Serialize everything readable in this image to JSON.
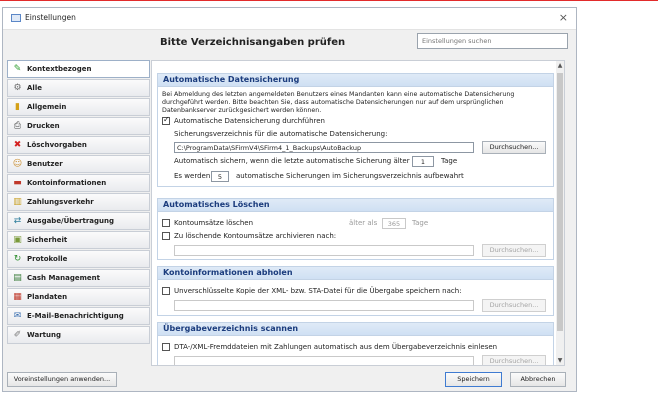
{
  "window": {
    "title": "Einstellungen",
    "close_glyph": "×"
  },
  "heading": "Bitte Verzeichnisangaben prüfen",
  "search": {
    "placeholder": "Einstellungen suchen"
  },
  "sidebar": {
    "items": [
      {
        "label": "Kontextbezogen",
        "icon": "pencil-icon",
        "glyph": "✎",
        "color": "#2f9e2f",
        "active": true
      },
      {
        "label": "Alle",
        "icon": "gears-icon",
        "glyph": "⚙",
        "color": "#6b6b6b"
      },
      {
        "label": "Allgemein",
        "icon": "ruler-icon",
        "glyph": "▮",
        "color": "#d4a017"
      },
      {
        "label": "Drucken",
        "icon": "printer-icon",
        "glyph": "⎙",
        "color": "#4a4a4a"
      },
      {
        "label": "Löschvorgaben",
        "icon": "delete-icon",
        "glyph": "✖",
        "color": "#d42020"
      },
      {
        "label": "Benutzer",
        "icon": "user-icon",
        "glyph": "☺",
        "color": "#c98b2a"
      },
      {
        "label": "Kontoinformationen",
        "icon": "account-icon",
        "glyph": "▬",
        "color": "#c0392b"
      },
      {
        "label": "Zahlungsverkehr",
        "icon": "payment-icon",
        "glyph": "▥",
        "color": "#c9a227"
      },
      {
        "label": "Ausgabe/Übertragung",
        "icon": "transfer-icon",
        "glyph": "⇄",
        "color": "#2e7d9c"
      },
      {
        "label": "Sicherheit",
        "icon": "lock-icon",
        "glyph": "▣",
        "color": "#7a9a3a"
      },
      {
        "label": "Protokolle",
        "icon": "log-icon",
        "glyph": "↻",
        "color": "#2f8f2f"
      },
      {
        "label": "Cash Management",
        "icon": "cash-icon",
        "glyph": "▤",
        "color": "#3a7d3a"
      },
      {
        "label": "Plandaten",
        "icon": "calendar-icon",
        "glyph": "▦",
        "color": "#c0392b"
      },
      {
        "label": "E-Mail-Benachrichtigung",
        "icon": "email-icon",
        "glyph": "✉",
        "color": "#3a6fb0"
      },
      {
        "label": "Wartung",
        "icon": "wrench-icon",
        "glyph": "✐",
        "color": "#7a7a7a"
      }
    ]
  },
  "sections": {
    "backup": {
      "title": "Automatische Datensicherung",
      "description": "Bei Abmeldung des letzten angemeldeten Benutzers eines Mandanten kann eine automatische Datensicherung durchgeführt werden. Bitte beachten Sie, dass automatische Datensicherungen nur auf dem ursprünglichen Datenbankserver zurückgesichert werden können.",
      "checkbox_label": "Automatische Datensicherung durchführen",
      "checked": true,
      "dir_label": "Sicherungsverzeichnis für die automatische Datensicherung:",
      "dir_value": "C:\\ProgramData\\SFirmV4\\SFirm4_1_Backups\\AutoBackup",
      "browse_label": "Durchsuchen...",
      "age_prefix": "Automatisch sichern, wenn die letzte automatische Sicherung älter ist als",
      "age_value": "1",
      "age_unit": "Tage",
      "keep_prefix": "Es werden",
      "keep_value": "5",
      "keep_suffix": "automatische Sicherungen im Sicherungsverzeichnis aufbewahrt"
    },
    "delete": {
      "title": "Automatisches Löschen",
      "checkbox1_label": "Kontoumsätze löschen",
      "older_prefix": "älter als",
      "older_value": "365",
      "older_unit": "Tage",
      "checkbox2_label": "Zu löschende Kontoumsätze archivieren nach:",
      "path_value": "",
      "browse_label": "Durchsuchen..."
    },
    "fetch": {
      "title": "Kontoinformationen abholen",
      "checkbox_label": "Unverschlüsselte Kopie der XML- bzw. STA-Datei für die Übergabe speichern nach:",
      "path_value": "",
      "browse_label": "Durchsuchen..."
    },
    "scan": {
      "title": "Übergabeverzeichnis scannen",
      "checkbox_label": "DTA-/XML-Fremddateien mit Zahlungen automatisch aus dem Übergabeverzeichnis einlesen",
      "path_value": "",
      "browse_label": "Durchsuchen..."
    }
  },
  "footer": {
    "defaults_label": "Voreinstellungen anwenden...",
    "save_label": "Speichern",
    "cancel_label": "Abbrechen"
  }
}
